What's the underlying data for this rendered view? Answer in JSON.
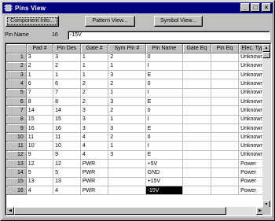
{
  "window": {
    "title": "Pins View"
  },
  "titlebar_buttons": {
    "minimize": "_",
    "maximize": "□",
    "close": "×"
  },
  "toolbar": {
    "component_info": "Component Info...",
    "pattern_view": "Pattern View...",
    "symbol_view": "Symbol View..."
  },
  "pin_name": {
    "label": "Pin Name",
    "number": "16",
    "value": "-15V"
  },
  "table": {
    "columns": [
      "Pad #",
      "Pin Des",
      "Gate #",
      "Sym Pin #",
      "Pin Name",
      "Gate Eq",
      "Pin Eq",
      "Elec. Type"
    ],
    "rows": [
      [
        "1",
        "3",
        "3",
        "1",
        "2",
        "0",
        "",
        "",
        "Unknown"
      ],
      [
        "2",
        "2",
        "2",
        "1",
        "1",
        "I",
        "",
        "",
        "Unknown"
      ],
      [
        "3",
        "1",
        "1",
        "1",
        "3",
        "E",
        "",
        "",
        "Unknown"
      ],
      [
        "4",
        "6",
        "6",
        "2",
        "2",
        "0",
        "",
        "",
        "Unknown"
      ],
      [
        "5",
        "7",
        "7",
        "2",
        "1",
        "I",
        "",
        "",
        "Unknown"
      ],
      [
        "6",
        "8",
        "8",
        "2",
        "3",
        "E",
        "",
        "",
        "Unknown"
      ],
      [
        "7",
        "14",
        "14",
        "3",
        "2",
        "0",
        "",
        "",
        "Unknown"
      ],
      [
        "8",
        "15",
        "15",
        "3",
        "1",
        "I",
        "",
        "",
        "Unknown"
      ],
      [
        "9",
        "16",
        "16",
        "3",
        "3",
        "E",
        "",
        "",
        "Unknown"
      ],
      [
        "10",
        "11",
        "11",
        "4",
        "2",
        "0",
        "",
        "",
        "Unknown"
      ],
      [
        "11",
        "10",
        "10",
        "4",
        "1",
        "I",
        "",
        "",
        "Unknown"
      ],
      [
        "12",
        "9",
        "9",
        "4",
        "3",
        "E",
        "",
        "",
        "Unknown"
      ],
      [
        "13",
        "12",
        "12",
        "PWR",
        "",
        "+5V",
        "",
        "",
        "Power"
      ],
      [
        "14",
        "5",
        "5",
        "PWR",
        "",
        "GND",
        "",
        "",
        "Power"
      ],
      [
        "15",
        "13",
        "13",
        "PWR",
        "",
        "+15V",
        "",
        "",
        "Power"
      ],
      [
        "16",
        "4",
        "4",
        "PWR",
        "",
        "-15V",
        "",
        "",
        "Power"
      ]
    ]
  },
  "scrollbars": {
    "up": "▲",
    "down": "▼",
    "left": "◀",
    "right": "▶"
  },
  "colors": {
    "titlebar": "#000080",
    "face": "#c0c0c0",
    "selection": "#000000"
  },
  "icons": {
    "title": "pins-view-app-icon"
  }
}
